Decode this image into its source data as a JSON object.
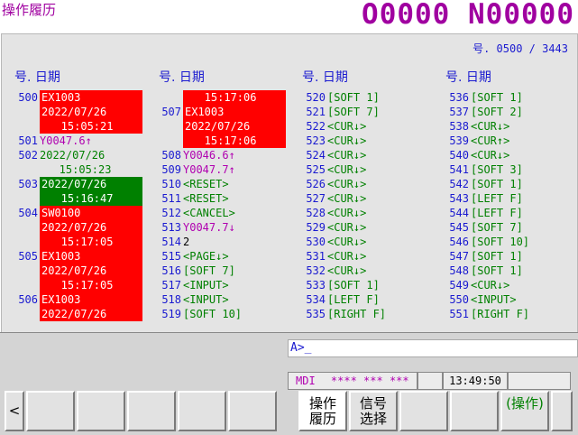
{
  "screen_title": "操作履历",
  "program_number": "O0000 N00000",
  "page_info": "号. 0500 / 3443",
  "column_header": "号. 日期",
  "columns": [
    [
      {
        "no": "500",
        "lines": [
          {
            "t": "EX1003",
            "fg": "white",
            "bg": "red"
          },
          {
            "t": "2022/07/26",
            "fg": "white",
            "bg": "red"
          },
          {
            "t": "   15:05:21",
            "fg": "white",
            "bg": "red"
          }
        ]
      },
      {
        "no": "501",
        "lines": [
          {
            "t": "Y0047.6↑",
            "fg": "magenta"
          }
        ]
      },
      {
        "no": "502",
        "lines": [
          {
            "t": "2022/07/26",
            "fg": "green"
          },
          {
            "t": "   15:05:23",
            "fg": "green"
          }
        ]
      },
      {
        "no": "503",
        "lines": [
          {
            "t": "2022/07/26",
            "fg": "white",
            "bg": "green"
          },
          {
            "t": "   15:16:47",
            "fg": "white",
            "bg": "green"
          }
        ]
      },
      {
        "no": "504",
        "lines": [
          {
            "t": "SW0100",
            "fg": "white",
            "bg": "red"
          },
          {
            "t": "2022/07/26",
            "fg": "white",
            "bg": "red"
          },
          {
            "t": "   15:17:05",
            "fg": "white",
            "bg": "red"
          }
        ]
      },
      {
        "no": "505",
        "lines": [
          {
            "t": "EX1003",
            "fg": "white",
            "bg": "red"
          },
          {
            "t": "2022/07/26",
            "fg": "white",
            "bg": "red"
          },
          {
            "t": "   15:17:05",
            "fg": "white",
            "bg": "red"
          }
        ]
      },
      {
        "no": "506",
        "lines": [
          {
            "t": "EX1003",
            "fg": "white",
            "bg": "red"
          },
          {
            "t": "2022/07/26",
            "fg": "white",
            "bg": "red"
          }
        ]
      }
    ],
    [
      {
        "no": "",
        "lines": [
          {
            "t": "   15:17:06",
            "fg": "white",
            "bg": "red"
          }
        ]
      },
      {
        "no": "507",
        "lines": [
          {
            "t": "EX1003",
            "fg": "white",
            "bg": "red"
          },
          {
            "t": "2022/07/26",
            "fg": "white",
            "bg": "red"
          },
          {
            "t": "   15:17:06",
            "fg": "white",
            "bg": "red"
          }
        ]
      },
      {
        "no": "508",
        "lines": [
          {
            "t": "Y0046.6↑",
            "fg": "magenta"
          }
        ]
      },
      {
        "no": "509",
        "lines": [
          {
            "t": "Y0047.7↑",
            "fg": "magenta"
          }
        ]
      },
      {
        "no": "510",
        "lines": [
          {
            "t": "<RESET>",
            "fg": "green"
          }
        ]
      },
      {
        "no": "511",
        "lines": [
          {
            "t": "<RESET>",
            "fg": "green"
          }
        ]
      },
      {
        "no": "512",
        "lines": [
          {
            "t": "<CANCEL>",
            "fg": "green"
          }
        ]
      },
      {
        "no": "513",
        "lines": [
          {
            "t": "Y0047.7↓",
            "fg": "magenta"
          }
        ]
      },
      {
        "no": "514",
        "lines": [
          {
            "t": "2",
            "fg": "black"
          }
        ]
      },
      {
        "no": "515",
        "lines": [
          {
            "t": "<PAGE↓>",
            "fg": "green"
          }
        ]
      },
      {
        "no": "516",
        "lines": [
          {
            "t": "[SOFT 7]",
            "fg": "green"
          }
        ]
      },
      {
        "no": "517",
        "lines": [
          {
            "t": "<INPUT>",
            "fg": "green"
          }
        ]
      },
      {
        "no": "518",
        "lines": [
          {
            "t": "<INPUT>",
            "fg": "green"
          }
        ]
      },
      {
        "no": "519",
        "lines": [
          {
            "t": "[SOFT 10]",
            "fg": "green"
          }
        ]
      }
    ],
    [
      {
        "no": "520",
        "lines": [
          {
            "t": "[SOFT 1]",
            "fg": "green"
          }
        ]
      },
      {
        "no": "521",
        "lines": [
          {
            "t": "[SOFT 7]",
            "fg": "green"
          }
        ]
      },
      {
        "no": "522",
        "lines": [
          {
            "t": "<CUR↓>",
            "fg": "green"
          }
        ]
      },
      {
        "no": "523",
        "lines": [
          {
            "t": "<CUR↓>",
            "fg": "green"
          }
        ]
      },
      {
        "no": "524",
        "lines": [
          {
            "t": "<CUR↓>",
            "fg": "green"
          }
        ]
      },
      {
        "no": "525",
        "lines": [
          {
            "t": "<CUR↓>",
            "fg": "green"
          }
        ]
      },
      {
        "no": "526",
        "lines": [
          {
            "t": "<CUR↓>",
            "fg": "green"
          }
        ]
      },
      {
        "no": "527",
        "lines": [
          {
            "t": "<CUR↓>",
            "fg": "green"
          }
        ]
      },
      {
        "no": "528",
        "lines": [
          {
            "t": "<CUR↓>",
            "fg": "green"
          }
        ]
      },
      {
        "no": "529",
        "lines": [
          {
            "t": "<CUR↓>",
            "fg": "green"
          }
        ]
      },
      {
        "no": "530",
        "lines": [
          {
            "t": "<CUR↓>",
            "fg": "green"
          }
        ]
      },
      {
        "no": "531",
        "lines": [
          {
            "t": "<CUR↓>",
            "fg": "green"
          }
        ]
      },
      {
        "no": "532",
        "lines": [
          {
            "t": "<CUR↓>",
            "fg": "green"
          }
        ]
      },
      {
        "no": "533",
        "lines": [
          {
            "t": "[SOFT 1]",
            "fg": "green"
          }
        ]
      },
      {
        "no": "534",
        "lines": [
          {
            "t": "[LEFT F]",
            "fg": "green"
          }
        ]
      },
      {
        "no": "535",
        "lines": [
          {
            "t": "[RIGHT F]",
            "fg": "green"
          }
        ]
      }
    ],
    [
      {
        "no": "536",
        "lines": [
          {
            "t": "[SOFT 1]",
            "fg": "green"
          }
        ]
      },
      {
        "no": "537",
        "lines": [
          {
            "t": "[SOFT 2]",
            "fg": "green"
          }
        ]
      },
      {
        "no": "538",
        "lines": [
          {
            "t": "<CUR↓>",
            "fg": "green"
          }
        ]
      },
      {
        "no": "539",
        "lines": [
          {
            "t": "<CUR↑>",
            "fg": "green"
          }
        ]
      },
      {
        "no": "540",
        "lines": [
          {
            "t": "<CUR↓>",
            "fg": "green"
          }
        ]
      },
      {
        "no": "541",
        "lines": [
          {
            "t": "[SOFT 3]",
            "fg": "green"
          }
        ]
      },
      {
        "no": "542",
        "lines": [
          {
            "t": "[SOFT 1]",
            "fg": "green"
          }
        ]
      },
      {
        "no": "543",
        "lines": [
          {
            "t": "[LEFT F]",
            "fg": "green"
          }
        ]
      },
      {
        "no": "544",
        "lines": [
          {
            "t": "[LEFT F]",
            "fg": "green"
          }
        ]
      },
      {
        "no": "545",
        "lines": [
          {
            "t": "[SOFT 7]",
            "fg": "green"
          }
        ]
      },
      {
        "no": "546",
        "lines": [
          {
            "t": "[SOFT 10]",
            "fg": "green"
          }
        ]
      },
      {
        "no": "547",
        "lines": [
          {
            "t": "[SOFT 1]",
            "fg": "green"
          }
        ]
      },
      {
        "no": "548",
        "lines": [
          {
            "t": "[SOFT 1]",
            "fg": "green"
          }
        ]
      },
      {
        "no": "549",
        "lines": [
          {
            "t": "<CUR↓>",
            "fg": "green"
          }
        ]
      },
      {
        "no": "550",
        "lines": [
          {
            "t": "<INPUT>",
            "fg": "green"
          }
        ]
      },
      {
        "no": "551",
        "lines": [
          {
            "t": "[RIGHT F]",
            "fg": "green"
          }
        ]
      }
    ]
  ],
  "command_line": {
    "prompt": "A>_"
  },
  "status": {
    "mode": "MDI",
    "indicators": "**** *** ***",
    "time": "13:49:50"
  },
  "softkeys": {
    "left_arrow": "<",
    "key1_line1": "操作",
    "key1_line2": "履历",
    "key2_line1": "信号",
    "key2_line2": "选择",
    "operate": "(操作)",
    "right_arrow": ""
  },
  "colors": {
    "red": "#ff0000",
    "green": "#008000",
    "magenta": "#b000b0",
    "blue": "#1a1ad0"
  }
}
